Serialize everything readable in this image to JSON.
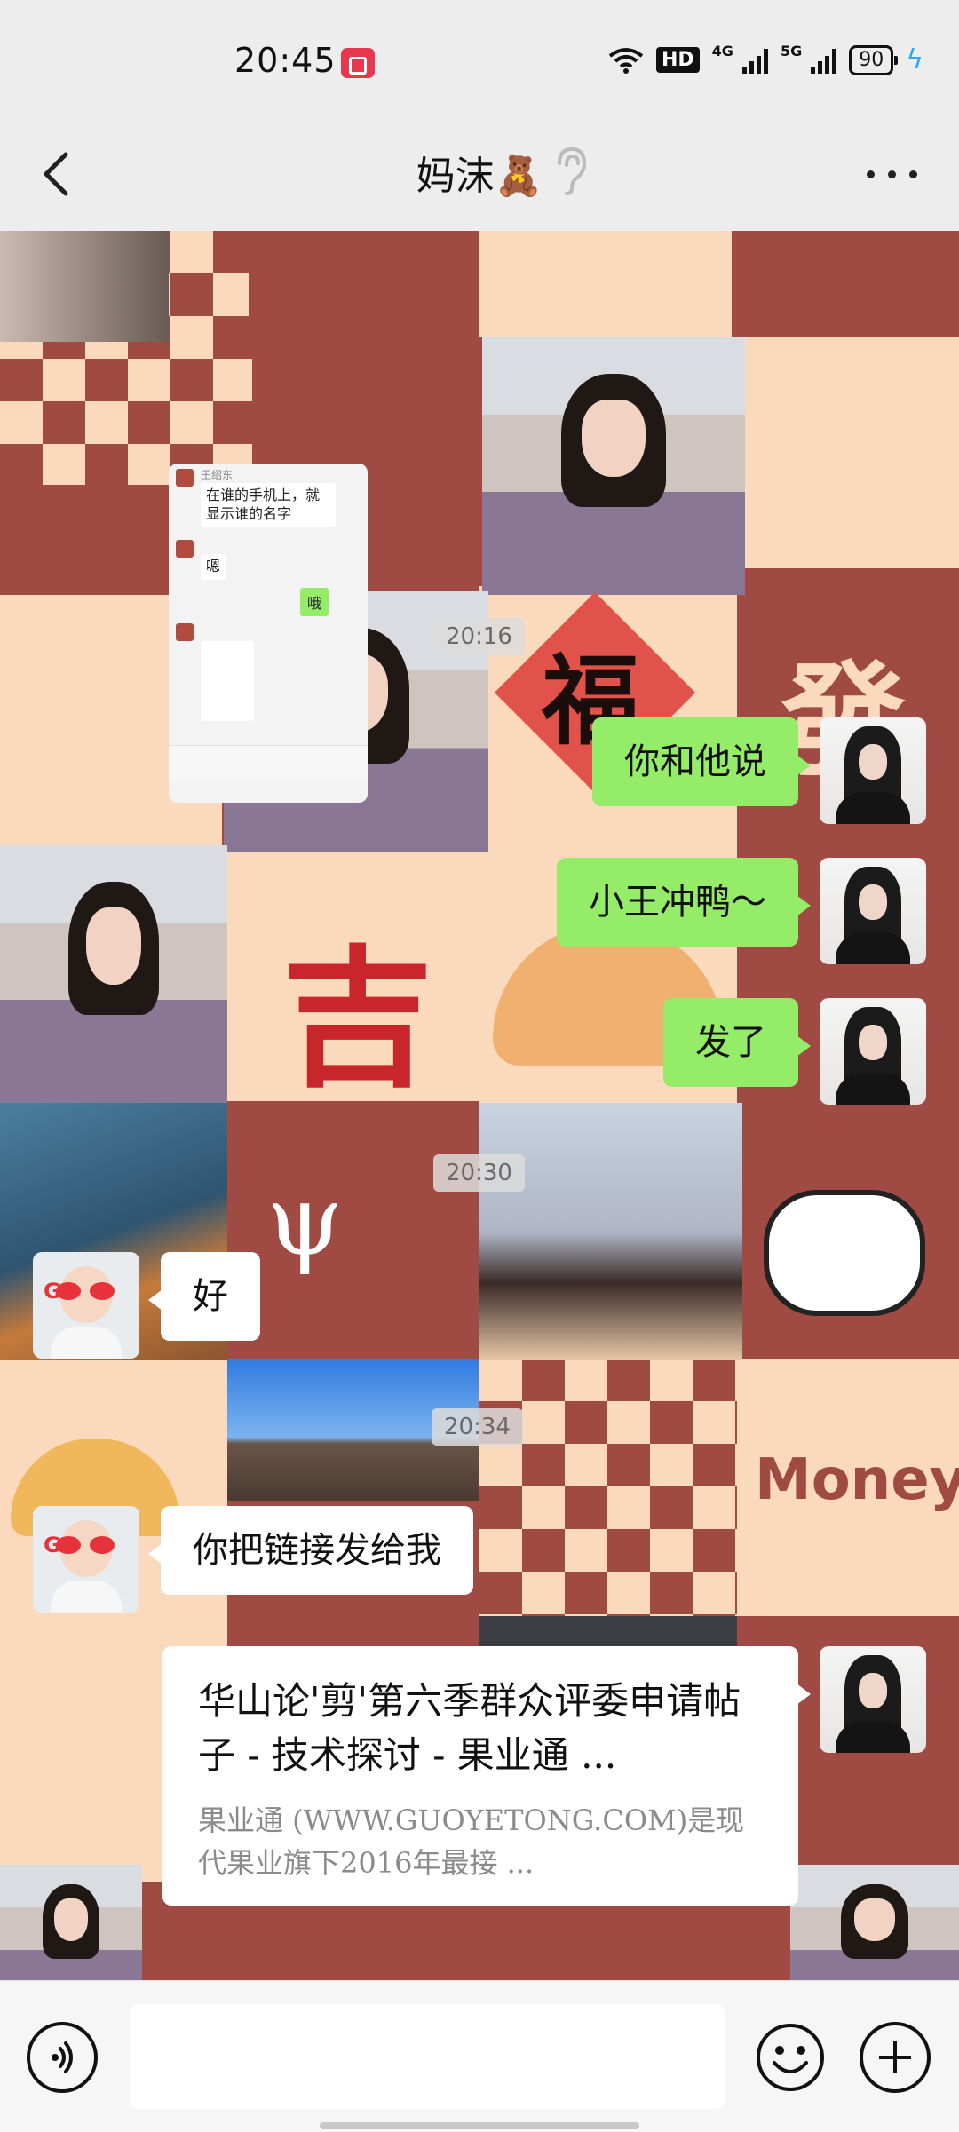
{
  "status_bar": {
    "time": "20:45",
    "hd_label": "HD",
    "network_1": "4G",
    "network_2": "5G",
    "battery": "90"
  },
  "header": {
    "title": "妈沫🧸"
  },
  "timestamps": [
    "20:16",
    "20:30",
    "20:34"
  ],
  "screenshot_image": {
    "sender_1": "王绍东",
    "line_1": "在谁的手机上，就显示谁的名字",
    "line_2": "嗯",
    "line_3": "哦"
  },
  "messages": [
    {
      "side": "right",
      "text": "你和他说"
    },
    {
      "side": "right",
      "text": "小王冲鸭～"
    },
    {
      "side": "right",
      "text": "发了"
    },
    {
      "side": "left",
      "text": "好"
    },
    {
      "side": "left",
      "text": "你把链接发给我"
    }
  ],
  "link_card": {
    "title": "华山论'剪'第六季群众评委申请帖子 - 技术探讨 - 果业通 ...",
    "desc": "果业通 (WWW.GUOYETONG.COM)是现代果业旗下2016年最接 ..."
  },
  "stickers": {
    "fu": "福",
    "ji": "吉",
    "fa": "發",
    "money": "Money"
  },
  "input_bar": {
    "placeholder": ""
  }
}
